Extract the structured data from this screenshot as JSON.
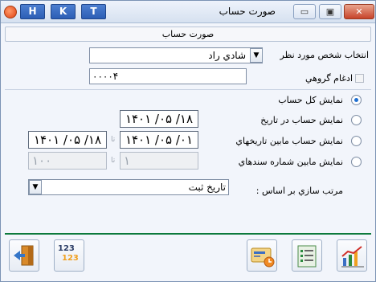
{
  "titlebar": {
    "title": "صورت حساب",
    "hkt": [
      "H",
      "K",
      "T"
    ],
    "minimize": "▭",
    "maximize": "▣",
    "close": "✕"
  },
  "header": {
    "text": "صورت حساب"
  },
  "person": {
    "label": "انتخاب شخص مورد نظر",
    "value": "شادي راد"
  },
  "group": {
    "label": "ادغام گروهي",
    "value": "۰۰۰۰۴"
  },
  "options": {
    "all": "نمايش كل حساب",
    "on_date": "نمايش حساب در تاريخ",
    "between_dates": "نمايش حساب مابين تاريخهاي",
    "between_docs": "نمايش مابين شماره سندهاي"
  },
  "dates": {
    "on_date": "۱۴۰۱ /۰۵ /۱۸",
    "from": "۱۴۰۱ /۰۵ /۰۱",
    "to": "۱۴۰۱ /۰۵ /۱۸",
    "doc_from": "۱",
    "doc_to": "۱۰۰",
    "to_label": "تا"
  },
  "sort": {
    "label": "مرتب سازي بر اساس :",
    "value": "تاريخ  ثبت"
  },
  "toolbar": {
    "num_a": "123",
    "num_b": "123"
  }
}
